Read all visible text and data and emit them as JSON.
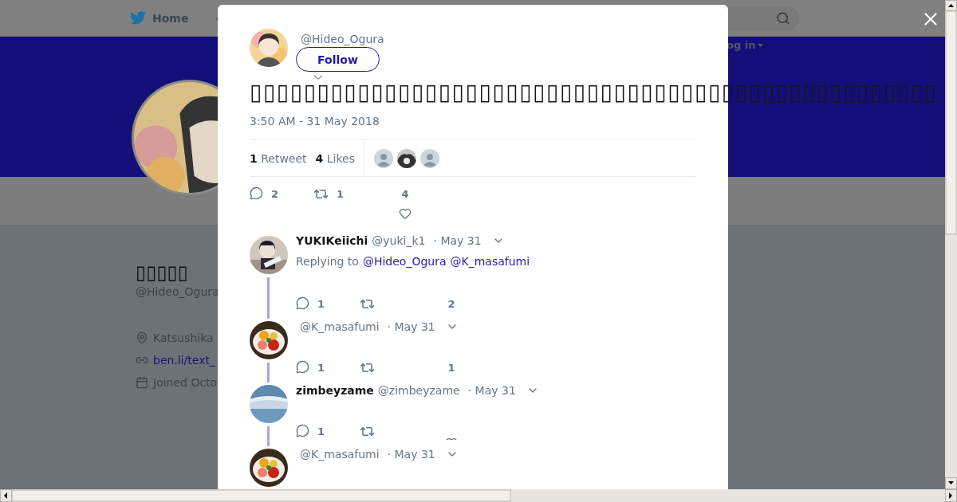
{
  "background": {
    "nav": {
      "home": "Home",
      "login": "og in"
    },
    "profile": {
      "name": "▯▯▯▯▯",
      "handle": "@Hideo_Ogura",
      "location": "Katsushika",
      "link": "ben.li/text_",
      "joined": "Joined Octo"
    }
  },
  "tweet": {
    "handle": "@Hideo_Ogura",
    "follow": "Follow",
    "text": "▯▯▯▯▯▯▯▯▯▯▯▯▯▯▯▯▯▯▯▯▯▯▯▯▯▯▯▯▯▯▯▯▯▯▯▯▯▯▯▯▯▯▯▯▯▯▯▯▯▯▯",
    "timestamp": "3:50 AM - 31 May 2018",
    "stats": [
      {
        "count": "1",
        "label": "Retweet"
      },
      {
        "count": "4",
        "label": "Likes"
      }
    ],
    "likers": [
      {
        "kind": "default"
      },
      {
        "kind": "picture"
      },
      {
        "kind": "default"
      }
    ],
    "actions": {
      "replies": "2",
      "retweets": "1",
      "likes": "4"
    }
  },
  "replies": [
    {
      "name": "YUKIKeiichi",
      "handle": "@yuki_k1",
      "date": "· May 31",
      "replying_to": {
        "label": "Replying to",
        "mentions": [
          "@Hideo_Ogura",
          "@K_masafumi"
        ]
      },
      "actions": {
        "replies": "1",
        "likes": "2"
      }
    },
    {
      "handle": "@K_masafumi",
      "date": "· May 31",
      "actions": {
        "replies": "1",
        "likes": "1"
      }
    },
    {
      "name": "zimbeyzame",
      "handle": "@zimbeyzame",
      "date": "· May 31",
      "actions": {
        "replies": "1"
      }
    },
    {
      "handle": "@K_masafumi",
      "date": "· May 31"
    }
  ]
}
